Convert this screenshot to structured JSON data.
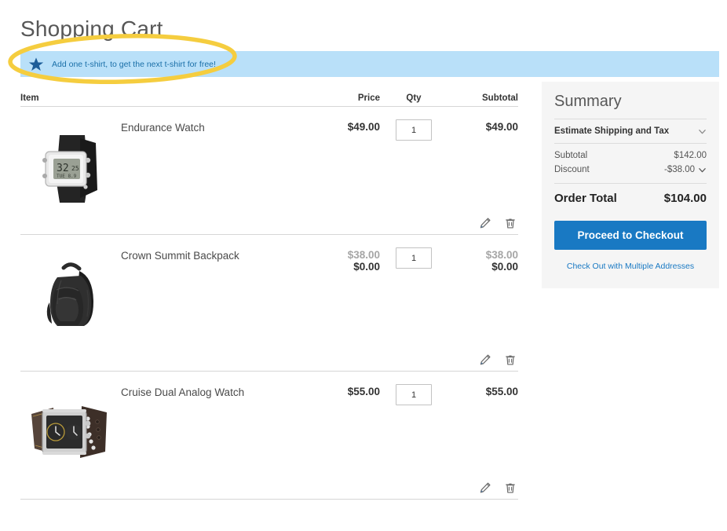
{
  "page": {
    "title": "Shopping Cart"
  },
  "notice": {
    "icon": "star-icon",
    "message": "Add one t-shirt, to get the next t-shirt for free!"
  },
  "annotation": {
    "shape": "ellipse-highlight",
    "color": "#f5cd3f"
  },
  "cart": {
    "headers": {
      "item": "Item",
      "price": "Price",
      "qty": "Qty",
      "subtotal": "Subtotal"
    },
    "actions": {
      "edit": "edit-icon",
      "remove": "trash-icon"
    },
    "items": [
      {
        "name": "Endurance Watch",
        "image": "endurance-watch",
        "price": "$49.00",
        "price_old": null,
        "qty": "1",
        "subtotal": "$49.00",
        "subtotal_old": null
      },
      {
        "name": "Crown Summit Backpack",
        "image": "crown-summit-backpack",
        "price": "$0.00",
        "price_old": "$38.00",
        "qty": "1",
        "subtotal": "$0.00",
        "subtotal_old": "$38.00"
      },
      {
        "name": "Cruise Dual Analog Watch",
        "image": "cruise-dual-analog-watch",
        "price": "$55.00",
        "price_old": null,
        "qty": "1",
        "subtotal": "$55.00",
        "subtotal_old": null
      }
    ]
  },
  "summary": {
    "title": "Summary",
    "estimate_label": "Estimate Shipping and Tax",
    "subtotal_label": "Subtotal",
    "subtotal_value": "$142.00",
    "discount_label": "Discount",
    "discount_value": "-$38.00",
    "order_total_label": "Order Total",
    "order_total_value": "$104.00",
    "checkout_label": "Proceed to Checkout",
    "multi_address_label": "Check Out with Multiple Addresses",
    "accent_color": "#1979c3"
  }
}
